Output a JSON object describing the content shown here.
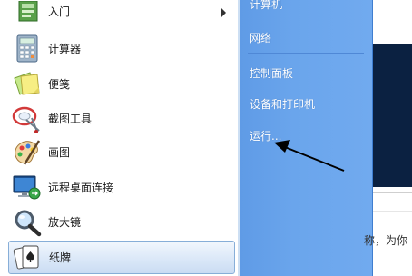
{
  "programs": [
    {
      "label": "入门",
      "icon": "getting-started-icon",
      "has_submenu": true
    },
    {
      "label": "计算器",
      "icon": "calculator-icon"
    },
    {
      "label": "便笺",
      "icon": "sticky-notes-icon"
    },
    {
      "label": "截图工具",
      "icon": "snipping-tool-icon"
    },
    {
      "label": "画图",
      "icon": "paint-icon"
    },
    {
      "label": "远程桌面连接",
      "icon": "remote-desktop-icon"
    },
    {
      "label": "放大镜",
      "icon": "magnifier-icon"
    },
    {
      "label": "纸牌",
      "icon": "solitaire-icon",
      "selected": true
    }
  ],
  "right_menu": {
    "computer": "计算机",
    "network": "网络",
    "control_panel": "控制面板",
    "devices_printers": "设备和打印机",
    "run": "运行..."
  },
  "background_window": {
    "partial_text": "称，为你"
  },
  "colors": {
    "right_panel": "#6aa5ec",
    "selected_item": "#dbe8f8",
    "arrow": "#000000"
  }
}
